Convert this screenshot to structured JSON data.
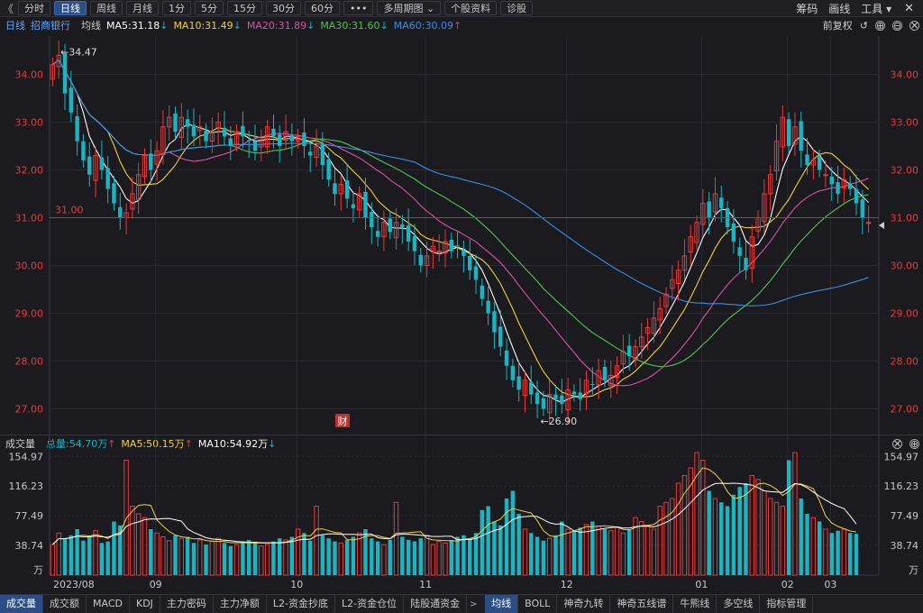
{
  "toolbar": {
    "back": "《",
    "buttons": [
      "分时",
      "日线",
      "周线",
      "月线",
      "1分",
      "5分",
      "15分",
      "30分",
      "60分",
      "•••",
      "多周期图 ⌄",
      "个股资料",
      "诊股"
    ],
    "active_index": 1,
    "right": {
      "chips": "筹码",
      "draw": "画线",
      "tools": "工具 ▾",
      "close": "✕"
    }
  },
  "legend": {
    "period": "日线",
    "stock": "招商银行",
    "ma_label": "均线",
    "ma5": "MA5:31.18",
    "ma5_arrow": "↓",
    "ma10": "MA10:31.49",
    "ma10_arrow": "↓",
    "ma20": "MA20:31.89",
    "ma20_arrow": "↓",
    "ma30": "MA30:31.60",
    "ma30_arrow": "↓",
    "ma60": "MA60:30.09",
    "ma60_arrow": "↑",
    "adjust": "前复权",
    "icons": [
      "↺",
      "⊕",
      "⊖",
      "✕"
    ]
  },
  "volume_legend": {
    "title": "成交量",
    "total": "总量:54.70万",
    "total_arrow": "↑",
    "ma5": "MA5:50.15万",
    "ma5_arrow": "↑",
    "ma10": "MA10:54.92万",
    "ma10_arrow": "↓",
    "icons": [
      "✕",
      "⊕"
    ]
  },
  "colors": {
    "ma5": "#ffffff",
    "ma10": "#f0d040",
    "ma20": "#e04fa8",
    "ma30": "#4cc94c",
    "ma60": "#3a8fe6",
    "up": "#e63b3b",
    "down": "#17b6c2",
    "bg": "#1a1a1f"
  },
  "price_axis": {
    "ticks": [
      "34.00",
      "33.00",
      "32.00",
      "31.00",
      "30.00",
      "29.00",
      "28.00",
      "27.00"
    ]
  },
  "volume_axis": {
    "ticks": [
      "154.97",
      "116.23",
      "77.49",
      "38.74",
      "万"
    ]
  },
  "date_axis": {
    "labels": [
      "2023/08",
      "09",
      "10",
      "11",
      "12",
      "01",
      "02",
      "03"
    ]
  },
  "annotations": {
    "high": "←34.47",
    "low": "←26.90",
    "ref_line": "31.00",
    "badge": "财"
  },
  "bottom_tabs": {
    "left": [
      "成交量",
      "成交额",
      "MACD",
      "KDJ",
      "主力密码",
      "主力净额",
      "L2-资金抄底",
      "L2-资金仓位",
      "陆股通资金"
    ],
    "right": [
      "均线",
      "BOLL",
      "神奇九转",
      "神奇五线谱",
      "牛熊线",
      "多空线",
      "指标管理"
    ]
  },
  "chart_data": {
    "type": "candlestick",
    "title": "招商银行 日线",
    "ylim": [
      26.5,
      34.8
    ],
    "high_mark": 34.47,
    "low_mark": 26.9,
    "ref_value": 31.0,
    "close": [
      34.2,
      34.4,
      33.6,
      33.2,
      32.6,
      32.2,
      31.9,
      32.3,
      32.0,
      31.6,
      31.3,
      31.0,
      31.1,
      31.5,
      31.9,
      32.3,
      32.0,
      32.4,
      32.9,
      33.1,
      32.8,
      33.1,
      32.9,
      32.7,
      32.9,
      32.6,
      32.8,
      33.0,
      32.7,
      32.5,
      32.8,
      32.7,
      32.6,
      32.4,
      32.6,
      32.9,
      32.7,
      32.5,
      32.8,
      32.6,
      32.7,
      32.5,
      32.3,
      32.5,
      32.1,
      31.8,
      31.5,
      31.7,
      31.4,
      31.2,
      31.5,
      31.0,
      30.8,
      30.6,
      30.9,
      30.7,
      30.9,
      30.8,
      30.5,
      30.3,
      30.0,
      30.2,
      30.4,
      30.3,
      30.5,
      30.3,
      30.4,
      30.2,
      29.9,
      29.7,
      29.3,
      29.0,
      28.6,
      28.3,
      27.9,
      27.6,
      27.4,
      27.6,
      27.3,
      27.1,
      27.0,
      27.3,
      27.2,
      27.1,
      27.4,
      27.3,
      27.2,
      27.6,
      27.5,
      27.8,
      27.6,
      27.7,
      27.9,
      28.2,
      28.1,
      28.3,
      28.5,
      28.7,
      28.9,
      29.1,
      29.4,
      29.7,
      29.9,
      30.2,
      30.6,
      30.9,
      31.3,
      31.0,
      31.5,
      31.2,
      30.8,
      30.5,
      30.2,
      29.9,
      30.6,
      31.0,
      31.5,
      31.9,
      32.6,
      33.1,
      32.5,
      32.9,
      32.4,
      32.1,
      32.2,
      32.0,
      31.9,
      31.7,
      31.5,
      31.8,
      31.6,
      31.3,
      31.0,
      30.9
    ],
    "volume": [
      40,
      55,
      48,
      52,
      60,
      45,
      50,
      58,
      42,
      44,
      70,
      65,
      150,
      90,
      80,
      75,
      60,
      55,
      50,
      45,
      52,
      48,
      50,
      42,
      46,
      40,
      44,
      48,
      42,
      38,
      40,
      44,
      46,
      42,
      38,
      40,
      44,
      48,
      46,
      50,
      60,
      55,
      45,
      90,
      52,
      48,
      44,
      42,
      46,
      50,
      55,
      60,
      48,
      44,
      40,
      46,
      95,
      50,
      46,
      44,
      48,
      52,
      40,
      44,
      42,
      46,
      50,
      52,
      48,
      55,
      85,
      90,
      70,
      65,
      100,
      110,
      80,
      60,
      55,
      50,
      45,
      48,
      52,
      70,
      60,
      58,
      62,
      66,
      70,
      64,
      60,
      58,
      62,
      55,
      60,
      75,
      70,
      65,
      60,
      90,
      95,
      100,
      120,
      130,
      140,
      160,
      150,
      110,
      100,
      95,
      90,
      105,
      115,
      120,
      130,
      125,
      110,
      100,
      95,
      90,
      150,
      160,
      100,
      80,
      75,
      70,
      60,
      55,
      58,
      60,
      55,
      54
    ]
  }
}
